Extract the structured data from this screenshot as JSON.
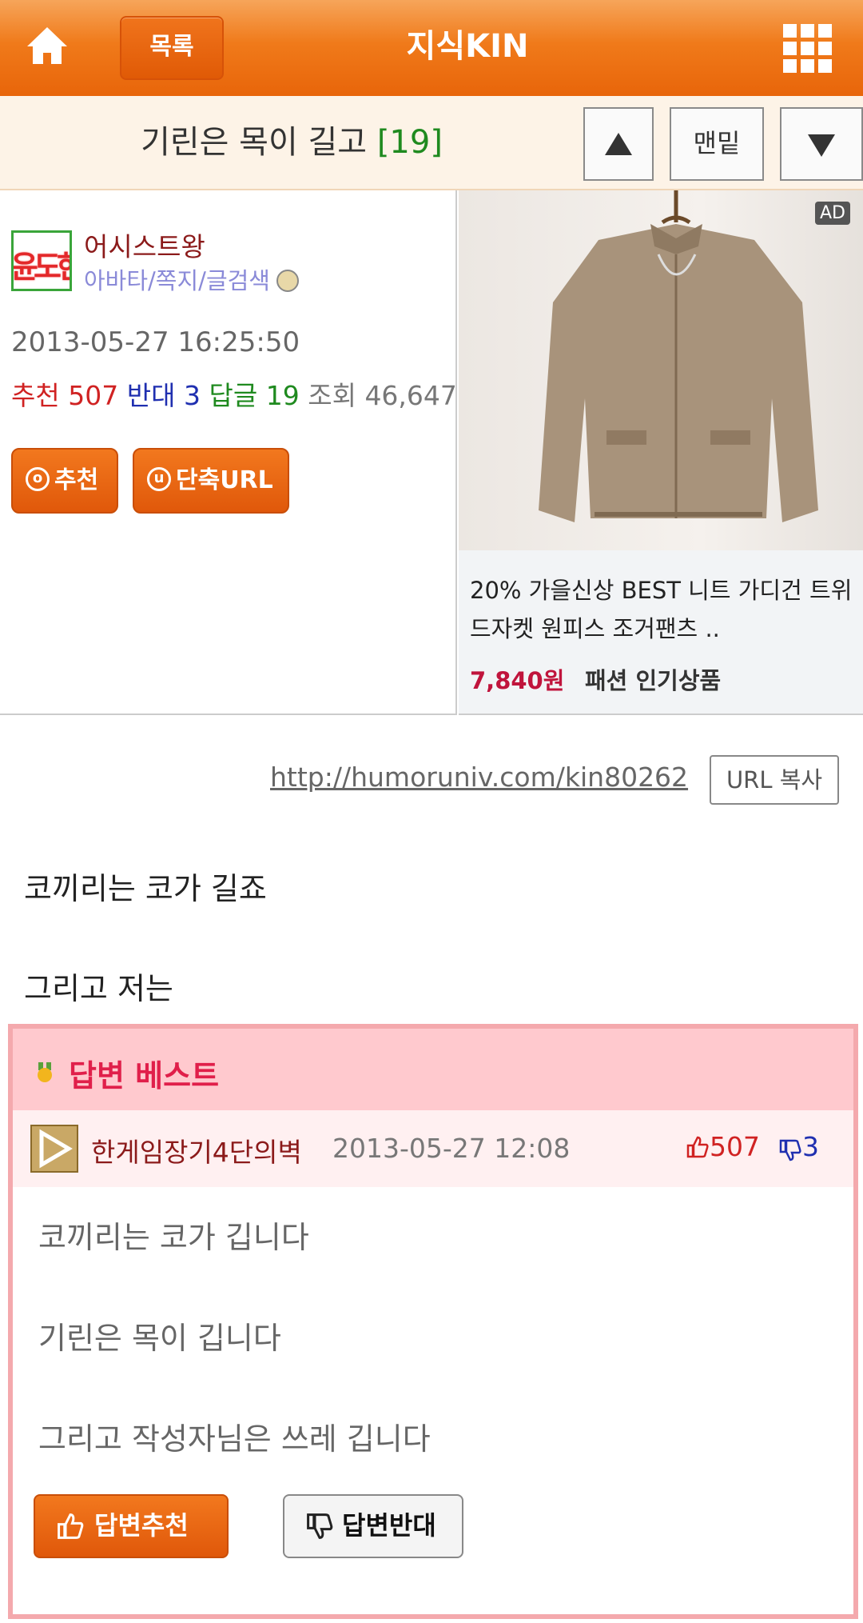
{
  "topbar": {
    "list_label": "목록",
    "app_title": "지식KIN"
  },
  "titlebar": {
    "title": "기린은 목이 길고",
    "reply_count": "[19]",
    "bottom_label": "맨밑"
  },
  "author": {
    "avatar_text": "윤도현",
    "name": "어시스트왕",
    "links": "아바타/쪽지/글검색",
    "date": "2013-05-27 16:25:50",
    "stats": {
      "recommend_label": "추천",
      "recommend_value": "507",
      "oppose_label": "반대",
      "oppose_value": "3",
      "reply_label": "답글",
      "reply_value": "19",
      "view_label": "조회",
      "view_value": "46,647"
    },
    "recommend_button": "추천",
    "shorturl_button": "단축URL"
  },
  "ad": {
    "label": "AD",
    "text": "20% 가을신상 BEST 니트 가디건 트위드자켓 원피스 조거팬츠 ..",
    "price": "7,840원",
    "tag": "패션 인기상품"
  },
  "url_row": {
    "url": "http://humoruniv.com/kin80262",
    "copy_label": "URL 복사"
  },
  "post_body": {
    "line1": "코끼리는 코가 길죠",
    "line2": "그리고 저는"
  },
  "best_answer": {
    "title": "답변 베스트",
    "author": "한게임장기4단의벽",
    "date": "2013-05-27 12:08",
    "up_count": "507",
    "down_count": "3",
    "lines": [
      "코끼리는 코가 깁니다",
      "기린은 목이 깁니다",
      "그리고 작성자님은 쓰레 깁니다"
    ],
    "recommend_button": "답변추천",
    "oppose_button": "답변반대"
  },
  "colors": {
    "accent_orange": "#ed6d12",
    "recommend_red": "#d02222",
    "oppose_blue": "#1f2fb0",
    "reply_green": "#1f8a1f",
    "best_pink": "#ffc9ce"
  }
}
